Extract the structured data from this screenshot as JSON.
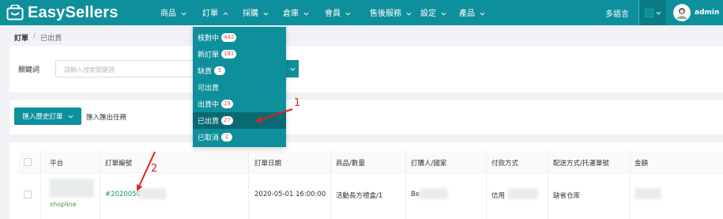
{
  "app": {
    "name": "EasySellers"
  },
  "nav": {
    "items": [
      {
        "label": "商品"
      },
      {
        "label": "訂單"
      },
      {
        "label": "採購"
      },
      {
        "label": "倉庫"
      },
      {
        "label": "會員"
      },
      {
        "label": "售後服務"
      },
      {
        "label": "設定"
      },
      {
        "label": "產品"
      }
    ],
    "language": "多語言",
    "user": "admin"
  },
  "breadcrumb": {
    "root": "訂單",
    "sep": "/",
    "current": "已出貨"
  },
  "search": {
    "label": "關鍵詞",
    "placeholder": "請輸入搜索關鍵詞"
  },
  "actions": {
    "import_label": "匯入歷史訂單",
    "task_label": "匯入匯出任務"
  },
  "dropdown": {
    "items": [
      {
        "label": "核對中",
        "count": "442"
      },
      {
        "label": "新訂單",
        "count": "181"
      },
      {
        "label": "缺貨",
        "count": "5"
      },
      {
        "label": "可出貨",
        "count": ""
      },
      {
        "label": "出貨中",
        "count": "19"
      },
      {
        "label": "已出貨",
        "count": "27"
      },
      {
        "label": "已取消",
        "count": "2"
      }
    ],
    "selected": "已出貨"
  },
  "table": {
    "headers": [
      "平台",
      "訂單編號",
      "訂單日期",
      "商品/數量",
      "訂購人/國家",
      "付款方式",
      "配送方式/托運單號",
      "金額"
    ],
    "row": {
      "platform": "shopline",
      "order_no": "#20200501",
      "date": "2020-05-01 16:00:00",
      "product": "活動長方禮盒/1",
      "buyer": "Be",
      "payment": "信用",
      "shipping": "缺省仓库"
    }
  },
  "annotations": {
    "one": "1",
    "two": "2"
  },
  "colors": {
    "primary": "#0e8f9c",
    "primary_dark": "#096a74",
    "annotation": "#e02020"
  }
}
